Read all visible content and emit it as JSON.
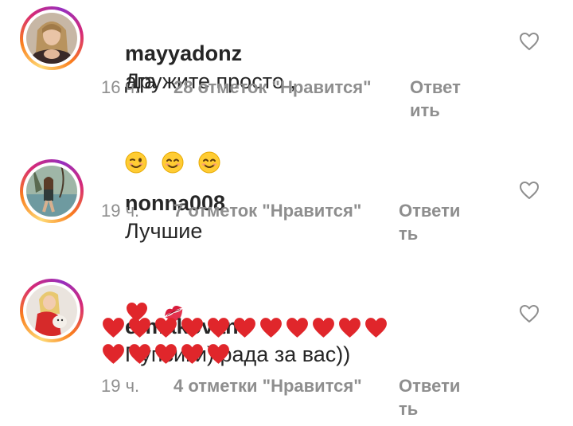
{
  "comments": [
    {
      "username": "mayyadonz",
      "text": "Дружите просто ,",
      "text_line2": "ага",
      "emojis_line2": [
        "winking-face-emoji",
        "smiling-face-emoji",
        "smiling-face-emoji"
      ],
      "time": "16 ч.",
      "likes": "28 отметок \"Нравится\"",
      "reply_line1": "Ответ",
      "reply_line2": "ить",
      "like_icon": "heart-outline-icon"
    },
    {
      "username": "nonna008",
      "text": "Лучшие",
      "emojis_line1": [
        "red-heart-emoji",
        "kiss-mark-emoji"
      ],
      "time": "19 ч.",
      "likes": "7 отметок \"Нравится\"",
      "reply_line1": "Ответи",
      "reply_line2": "ть",
      "like_icon": "heart-outline-icon"
    },
    {
      "username": "ermakovan",
      "text": "Пупсики) рада за вас))",
      "hearts_line2": 11,
      "hearts_line3": 5,
      "time": "19 ч.",
      "likes": "4 отметки \"Нравится\"",
      "reply_line1": "Ответи",
      "reply_line2": "ть",
      "like_icon": "heart-outline-icon"
    }
  ],
  "colors": {
    "text": "#262626",
    "meta": "#8e8e8e",
    "heart": "#e0262b",
    "ring_start": "#feda75",
    "ring_mid": "#d62976",
    "ring_end": "#962fbf"
  }
}
